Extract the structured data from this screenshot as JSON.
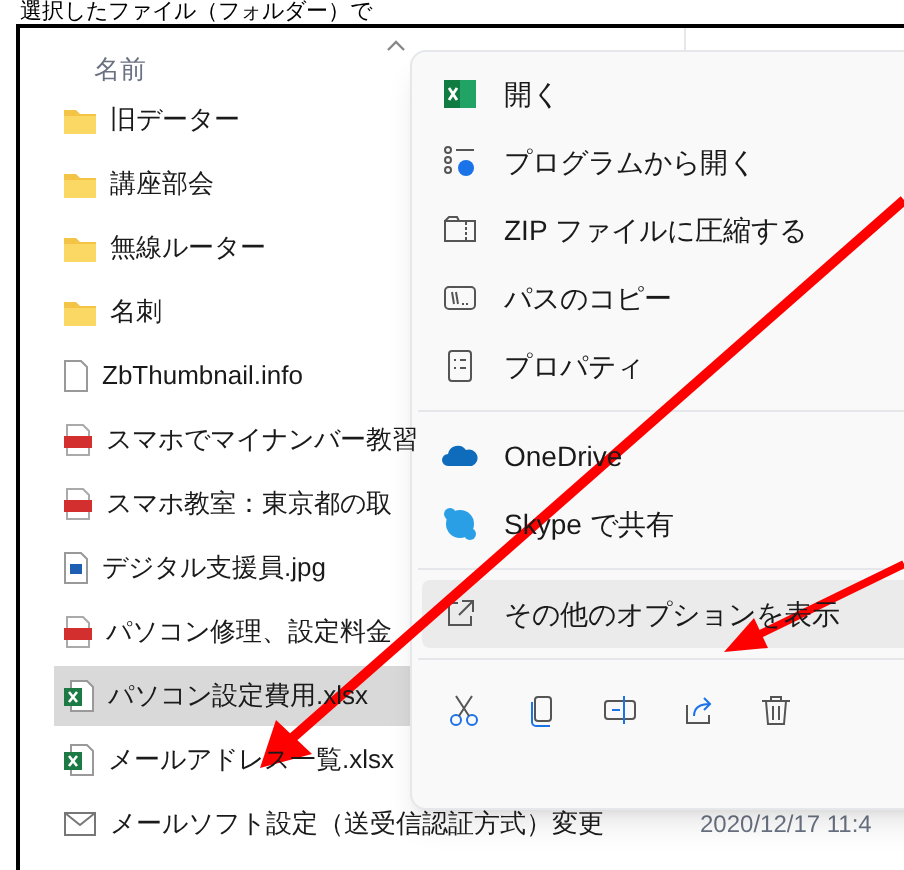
{
  "heading": "選択したファイル（フォルダー）で",
  "column_header": {
    "label": "名前"
  },
  "files": [
    {
      "name": "旧データー",
      "kind": "folder",
      "selected": false
    },
    {
      "name": "講座部会",
      "kind": "folder",
      "selected": false
    },
    {
      "name": "無線ルーター",
      "kind": "folder",
      "selected": false
    },
    {
      "name": "名刺",
      "kind": "folder",
      "selected": false
    },
    {
      "name": "ZbThumbnail.info",
      "kind": "file",
      "selected": false
    },
    {
      "name": "スマホでマイナンバー教習",
      "kind": "pdf",
      "selected": false
    },
    {
      "name": "スマホ教室：東京都の取",
      "kind": "pdf",
      "selected": false
    },
    {
      "name": "デジタル支援員.jpg",
      "kind": "image",
      "selected": false
    },
    {
      "name": "パソコン修理、設定料金",
      "kind": "pdf",
      "selected": false
    },
    {
      "name": "パソコン設定費用.xlsx",
      "kind": "excel",
      "selected": true
    },
    {
      "name": "メールアドレス一覧.xlsx",
      "kind": "excel",
      "selected": false
    },
    {
      "name": "メールソフト設定（送受信認証方式）変更",
      "kind": "mail",
      "selected": false,
      "date": "2020/12/17 11:4"
    }
  ],
  "context_menu": {
    "groups": [
      [
        {
          "label": "開く",
          "kind": "excel",
          "selected": false
        },
        {
          "label": "プログラムから開く",
          "kind": "openwith",
          "selected": false
        },
        {
          "label": "ZIP ファイルに圧縮する",
          "kind": "zip",
          "selected": false
        },
        {
          "label": "パスのコピー",
          "kind": "path",
          "selected": false
        },
        {
          "label": "プロパティ",
          "kind": "properties",
          "selected": false
        }
      ],
      [
        {
          "label": "OneDrive",
          "kind": "cloud",
          "selected": false
        },
        {
          "label": "Skype で共有",
          "kind": "skype",
          "selected": false
        }
      ],
      [
        {
          "label": "その他のオプションを表示",
          "kind": "more",
          "selected": true
        }
      ]
    ],
    "actions": [
      {
        "kind": "cut"
      },
      {
        "kind": "copy"
      },
      {
        "kind": "rename"
      },
      {
        "kind": "share"
      },
      {
        "kind": "delete"
      }
    ]
  }
}
